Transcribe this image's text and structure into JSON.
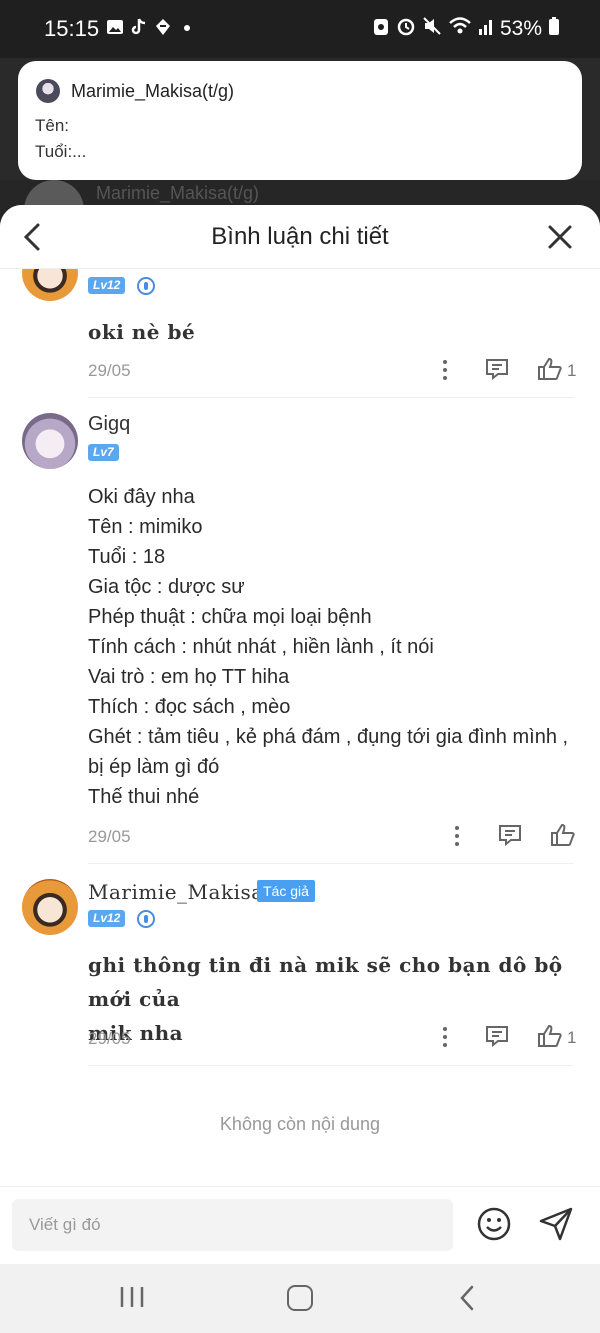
{
  "status_bar": {
    "time": "15:15",
    "battery": "53%",
    "left_icons": [
      "gallery-icon",
      "tiktok-icon",
      "app-icon",
      "dot-icon"
    ],
    "right_icons": [
      "recycle-icon",
      "alarm-icon",
      "mute-icon",
      "wifi-icon",
      "signal-icon",
      "battery-icon"
    ]
  },
  "background_comment": {
    "name": "Marimie_Makisa(t/g)"
  },
  "popup": {
    "title": "Marimie_Makisa(t/g)",
    "line1": "Tên:",
    "line2": "Tuổi:..."
  },
  "sheet": {
    "title": "Bình luận chi tiết"
  },
  "comments": [
    {
      "username": "",
      "level": "Lv12",
      "text": "oki nè bé",
      "date": "29/05",
      "likes": "1"
    },
    {
      "username": "Gigq",
      "level": "Lv7",
      "lines": [
        "Oki đây nha",
        "Tên : mimiko",
        "Tuổi : 18",
        "Gia tộc : dược sư",
        "Phép thuật : chữa mọi loại bệnh",
        "Tính cách : nhút nhát , hiền lành , ít nói",
        "Vai trò : em họ TT hiha",
        "Thích : đọc sách , mèo",
        "Ghét : tảm tiêu , kẻ phá đám , đụng tới gia đình mình ,",
        "bị ép làm gì đó",
        "Thế thui nhé"
      ],
      "date": "29/05",
      "likes": ""
    },
    {
      "username": "Marimie_Makisa",
      "author_tag": "Tác giả",
      "level": "Lv12",
      "lines": [
        "ghi thông tin đi nà mik sẽ cho bạn dô bộ mới của",
        "mik nha"
      ],
      "date": "29/05",
      "likes": "1"
    }
  ],
  "end_text": "Không còn nội dung",
  "input": {
    "placeholder": "Viết gì đó"
  },
  "colors": {
    "level_badge": "#5aa7f0",
    "author_tag": "#4aa0f0",
    "muted": "#999999"
  }
}
